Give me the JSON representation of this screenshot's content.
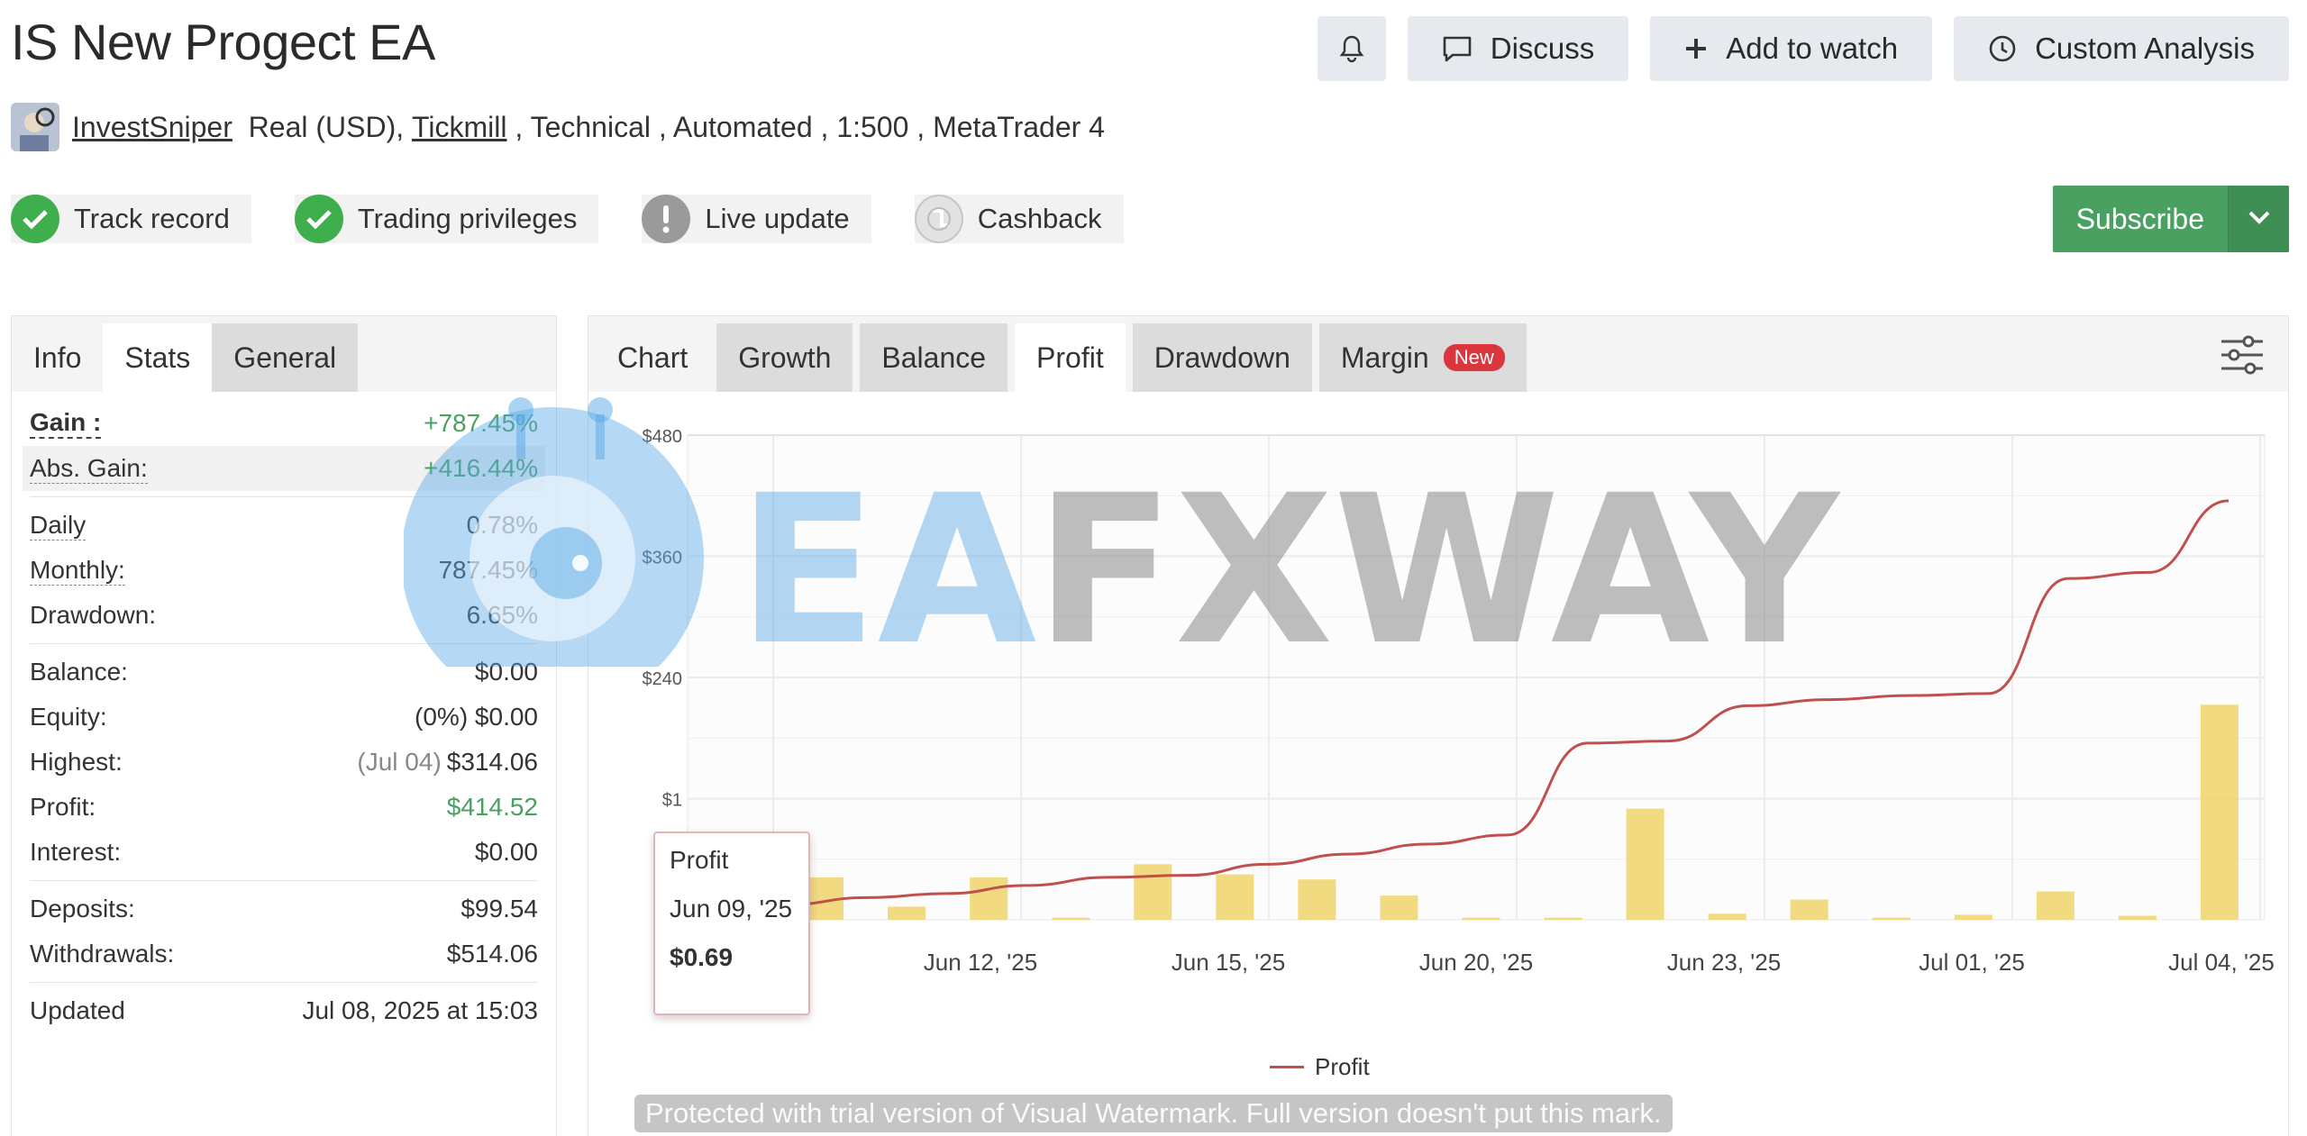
{
  "title": "IS New Progect EA",
  "actions": {
    "discuss": "Discuss",
    "watch": "Add to watch",
    "analysis": "Custom Analysis"
  },
  "meta": {
    "author": "InvestSniper",
    "account": "Real (USD),",
    "broker": "Tickmill",
    "details": " , Technical , Automated , 1:500 , MetaTrader 4"
  },
  "badges": [
    "Track record",
    "Trading privileges",
    "Live update",
    "Cashback"
  ],
  "subscribe": "Subscribe",
  "left_tabs": [
    "Info",
    "Stats",
    "General"
  ],
  "stats": {
    "gain_label": "Gain :",
    "gain": "+787.45%",
    "abs_label": "Abs. Gain:",
    "abs": "+416.44%",
    "daily_label": "Daily",
    "daily": "0.78%",
    "monthly_label": "Monthly:",
    "monthly": "787.45%",
    "drawdown_label": "Drawdown:",
    "drawdown": "6.65%",
    "balance_label": "Balance:",
    "balance": "$0.00",
    "equity_label": "Equity:",
    "equity": "(0%) $0.00",
    "highest_label": "Highest:",
    "highest_date": "(Jul 04)",
    "highest": "$314.06",
    "profit_label": "Profit:",
    "profit": "$414.52",
    "interest_label": "Interest:",
    "interest": "$0.00",
    "deposits_label": "Deposits:",
    "deposits": "$99.54",
    "withdrawals_label": "Withdrawals:",
    "withdrawals": "$514.06",
    "updated_label": "Updated",
    "updated": "Jul 08, 2025 at 15:03"
  },
  "chart_tabs": {
    "label": "Chart",
    "growth": "Growth",
    "balance": "Balance",
    "profit": "Profit",
    "drawdown": "Drawdown",
    "margin": "Margin",
    "new": "New"
  },
  "tooltip": {
    "series": "Profit",
    "date": "Jun 09, '25",
    "value": "$0.69"
  },
  "watermark": {
    "ea": "EA",
    "fxway": "FXWAY"
  },
  "trial_notice": "Protected with trial version of Visual Watermark. Full version doesn't put this mark.",
  "colors": {
    "line": "#c0504d",
    "bar": "#f0d36a",
    "green": "#4aa061"
  },
  "chart_data": {
    "type": "line",
    "y_ticks": [
      "$480",
      "$360",
      "$240",
      "$1"
    ],
    "ylim": [
      0,
      480
    ],
    "x_ticks": [
      "Jun 12, '25",
      "Jun 15, '25",
      "Jun 20, '25",
      "Jun 23, '25",
      "Jul 01, '25",
      "Jul 04, '25"
    ],
    "series": [
      {
        "name": "Profit",
        "values": [
          15,
          22,
          26,
          34,
          42,
          44,
          55,
          65,
          75,
          84,
          175,
          177,
          212,
          218,
          222,
          224,
          338,
          344,
          415
        ]
      }
    ],
    "bars": [
      18,
      42,
      13,
      42,
      2,
      55,
      45,
      40,
      24,
      2,
      2,
      110,
      6,
      20,
      2,
      5,
      28,
      4,
      213
    ]
  }
}
